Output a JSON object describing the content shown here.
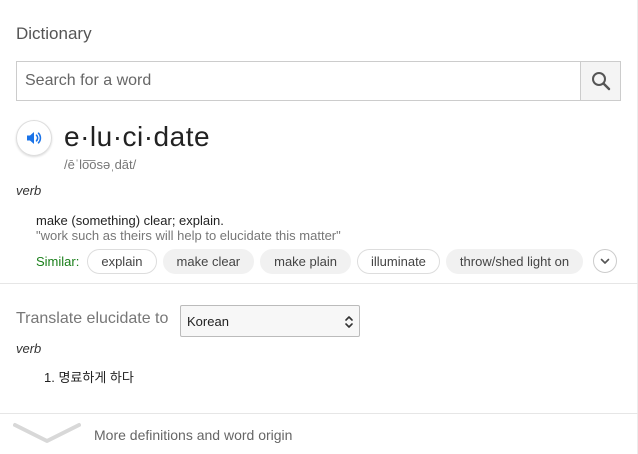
{
  "dictionary": {
    "title": "Dictionary",
    "search": {
      "placeholder": "Search for a word",
      "value": ""
    },
    "entry": {
      "word": "e·lu·ci·date",
      "pronunciation": "/ēˈlo͞osəˌdāt/",
      "part_of_speech": "verb",
      "definition": "make (something) clear; explain.",
      "example": "\"work such as theirs will help to elucidate this matter\"",
      "similar_label": "Similar:",
      "similar": [
        "explain",
        "make clear",
        "make plain",
        "illuminate",
        "throw/shed light on"
      ]
    },
    "translate": {
      "label": "Translate elucidate to",
      "language": "Korean",
      "part_of_speech": "verb",
      "items": [
        "1.  명료하게 하다"
      ]
    },
    "more_label": "More definitions and word origin",
    "colors": {
      "similar_label": "#1a7f1a",
      "speaker_icon": "#1a73e8"
    },
    "icons": {
      "search": "search-icon",
      "speaker": "speaker-icon",
      "expand": "chevron-down-icon",
      "more": "chevron-down-icon"
    }
  }
}
